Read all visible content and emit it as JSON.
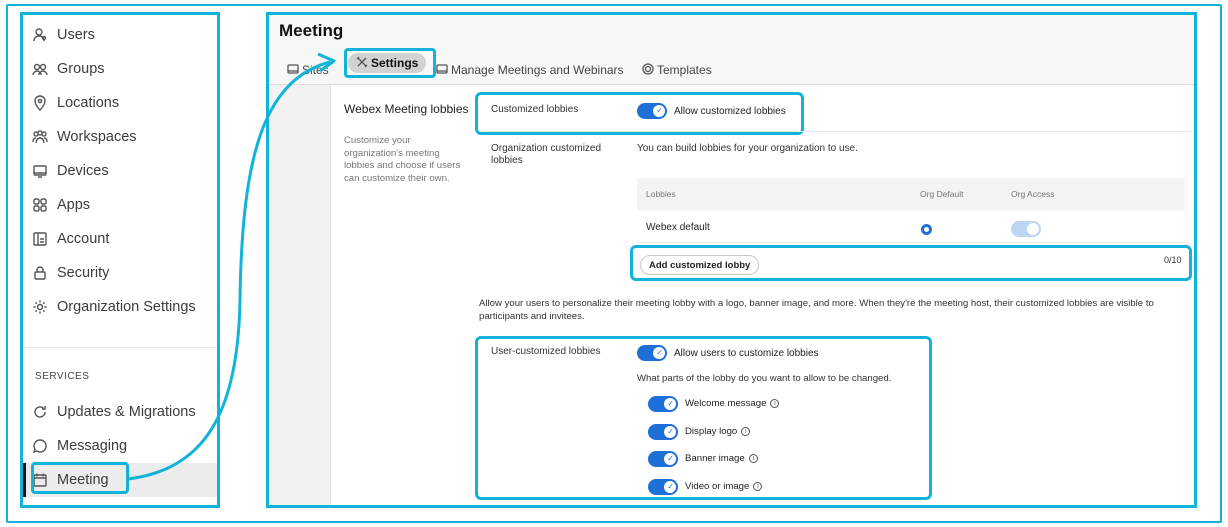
{
  "sidebar": {
    "items": [
      {
        "label": "Users",
        "icon": "users-icon"
      },
      {
        "label": "Groups",
        "icon": "groups-icon"
      },
      {
        "label": "Locations",
        "icon": "location-pin-icon"
      },
      {
        "label": "Workspaces",
        "icon": "workspaces-icon"
      },
      {
        "label": "Devices",
        "icon": "devices-icon"
      },
      {
        "label": "Apps",
        "icon": "apps-grid-icon"
      },
      {
        "label": "Account",
        "icon": "account-icon"
      },
      {
        "label": "Security",
        "icon": "lock-icon"
      },
      {
        "label": "Organization Settings",
        "icon": "gear-icon"
      }
    ],
    "services_header": "SERVICES",
    "services": [
      {
        "label": "Updates & Migrations",
        "icon": "refresh-icon"
      },
      {
        "label": "Messaging",
        "icon": "chat-bubble-icon"
      },
      {
        "label": "Meeting",
        "icon": "calendar-icon",
        "active": true
      }
    ]
  },
  "main": {
    "title": "Meeting",
    "tabs": [
      {
        "label": "Sites",
        "icon": "sites-icon"
      },
      {
        "label": "Settings",
        "icon": "tools-icon",
        "active": true
      },
      {
        "label": "Manage Meetings and Webinars",
        "icon": "monitor-icon"
      },
      {
        "label": "Templates",
        "icon": "templates-icon"
      }
    ],
    "section_title": "Webex Meeting lobbies",
    "section_desc": "Customize your organization's meeting lobbies and choose if users can customize their own.",
    "customized_lobbies": {
      "label": "Customized lobbies",
      "toggle_label": "Allow customized lobbies",
      "enabled": true
    },
    "org_lobbies": {
      "label": "Organization customized lobbies",
      "desc": "You can build lobbies for your organization to use.",
      "columns": [
        "Lobbies",
        "Org Default",
        "Org Access"
      ],
      "rows": [
        {
          "name": "Webex default",
          "org_default": true,
          "org_access": true
        }
      ],
      "add_button": "Add customized lobby",
      "count": "0/10"
    },
    "personalize_desc": "Allow your users to personalize their meeting lobby with a logo, banner image, and more. When they're the meeting host, their customized lobbies are visible to participants and invitees.",
    "user_lobbies": {
      "label": "User-customized lobbies",
      "toggle_label": "Allow users to customize lobbies",
      "question": "What parts of the lobby do you want to allow to be changed.",
      "options": [
        {
          "label": "Welcome message",
          "enabled": true
        },
        {
          "label": "Display logo",
          "enabled": true
        },
        {
          "label": "Banner image",
          "enabled": true
        },
        {
          "label": "Video or image",
          "enabled": true
        }
      ]
    }
  },
  "colors": {
    "highlight": "#12b3d9",
    "toggle_on": "#1f6fd8"
  }
}
